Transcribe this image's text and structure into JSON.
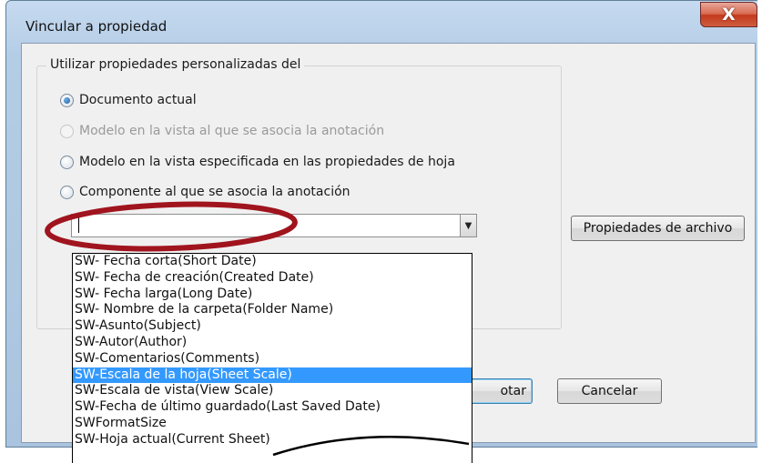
{
  "window": {
    "title": "Vincular a propiedad",
    "close_glyph": "X"
  },
  "group": {
    "legend": "Utilizar propiedades personalizadas del",
    "radios": [
      {
        "label": "Documento actual",
        "checked": true,
        "disabled": false
      },
      {
        "label": "Modelo en la vista al que se asocia la anotación",
        "checked": false,
        "disabled": true
      },
      {
        "label": "Modelo en la vista especificada en las propiedades de hoja",
        "checked": false,
        "disabled": false
      },
      {
        "label": "Componente al que se asocia la anotación",
        "checked": false,
        "disabled": false
      }
    ]
  },
  "combo": {
    "value": "",
    "arrow_icon": "chevron-down-icon"
  },
  "buttons": {
    "file_properties": "Propiedades de archivo",
    "accept_partial": "otar",
    "cancel": "Cancelar"
  },
  "dropdown": {
    "items": [
      "SW- Fecha corta(Short Date)",
      "SW- Fecha de creación(Created Date)",
      "SW- Fecha larga(Long Date)",
      "SW- Nombre de la carpeta(Folder Name)",
      "SW-Asunto(Subject)",
      "SW-Autor(Author)",
      "SW-Comentarios(Comments)",
      "SW-Escala de la hoja(Sheet Scale)",
      "SW-Escala de vista(View Scale)",
      "SW-Fecha de último guardado(Last Saved Date)",
      "SWFormatSize",
      "SW-Hoja actual(Current Sheet)"
    ],
    "selected_index": 7
  },
  "colors": {
    "selection": "#3399ff",
    "annotation_ellipse": "#a0141e",
    "close_button": "#c4391b"
  }
}
